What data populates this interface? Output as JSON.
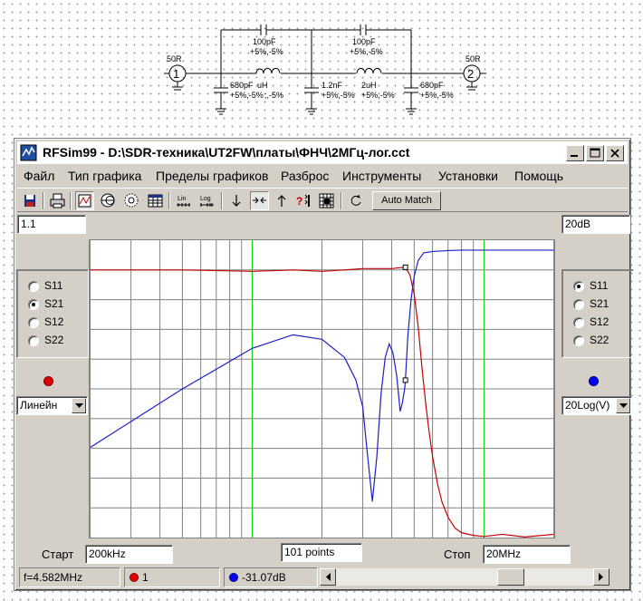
{
  "schematic": {
    "port1": {
      "name": "50R",
      "number": "1"
    },
    "port2": {
      "name": "50R",
      "number": "2"
    },
    "cap_top_1": {
      "value": "100pF",
      "tol": "+5%,-5%"
    },
    "cap_top_2": {
      "value": "100pF",
      "tol": "+5%,-5%"
    },
    "ind_1": {
      "value": "uH",
      "tol": ";,-5%"
    },
    "ind_2": {
      "value": "2uH",
      "tol": "+5%,-5%"
    },
    "cap_shunt_1": {
      "value": "680pF",
      "tol": "+5%,-5%"
    },
    "cap_shunt_2": {
      "value": "1.2nF",
      "tol": "+5%,-5%"
    },
    "cap_shunt_3": {
      "value": "680pF",
      "tol": "+5%,-5%"
    }
  },
  "window": {
    "title": "RFSim99 - D:\\SDR-техника\\UT2FW\\платы\\ФНЧ\\2МГц-лог.cct"
  },
  "menu": [
    "Файл",
    "Тип графика",
    "Пределы графиков",
    "Разброс",
    "Инструменты",
    "Установки",
    "Помощь"
  ],
  "toolbar": {
    "automatch_label": "Auto Match",
    "icons": [
      "save-icon",
      "print-icon",
      "rect-plot-icon",
      "smith-chart-icon",
      "polar-chart-icon",
      "table-icon",
      "lin-scale-icon",
      "log-scale-icon",
      "marker-down-icon",
      "marker-center-icon",
      "marker-up-icon",
      "help-context-icon",
      "grid-icon",
      "rotate-icon"
    ],
    "lin_label": "Lin",
    "log_label": "Log"
  },
  "left": {
    "scale_value": "1.1",
    "radio_options": [
      "S11",
      "S21",
      "S12",
      "S22"
    ],
    "selected": "S21",
    "indicator_color": "#dd0000",
    "scale_mode": "Линейн"
  },
  "right": {
    "scale_value": "20dB",
    "radio_options": [
      "S11",
      "S21",
      "S12",
      "S22"
    ],
    "selected": "S11",
    "indicator_color": "#0000ee",
    "scale_mode": "20Log(V)"
  },
  "bottom": {
    "start_label": "Старт",
    "start_value": "200kHz",
    "points_value": "101 points",
    "stop_label": "Стоп",
    "stop_value": "20MHz"
  },
  "status": {
    "frequency": "f=4.582MHz",
    "trace1_value": "1",
    "trace2_value": "-31.07dB"
  },
  "chart_data": {
    "type": "line",
    "x_scale": "log",
    "x_range": [
      "200kHz",
      "20MHz"
    ],
    "grid": true,
    "series": [
      {
        "color": "#c00000",
        "axis": "left",
        "x_mhz": [
          0.2,
          0.5,
          1.0,
          1.5,
          2.0,
          2.5,
          3.0,
          3.5,
          4.0,
          4.3,
          4.582,
          4.8,
          5.0,
          5.2,
          5.4,
          5.6,
          5.8,
          6.0,
          6.3,
          6.6,
          7.0,
          7.5,
          8.0,
          9.0,
          10.0,
          12.0,
          15.0,
          20.0
        ],
        "y": [
          0.99,
          0.99,
          0.985,
          0.99,
          0.985,
          0.99,
          0.995,
          0.995,
          0.995,
          0.998,
          1.0,
          0.97,
          0.9,
          0.78,
          0.63,
          0.5,
          0.39,
          0.3,
          0.2,
          0.13,
          0.075,
          0.035,
          0.018,
          0.008,
          0.004,
          0.012,
          0.002,
          0.012
        ]
      },
      {
        "color": "#1c1cc8",
        "axis": "right",
        "x_mhz": [
          0.2,
          0.5,
          1.0,
          1.5,
          2.0,
          2.5,
          2.8,
          3.0,
          3.15,
          3.3,
          3.45,
          3.6,
          3.75,
          3.9,
          4.05,
          4.2,
          4.35,
          4.45,
          4.55,
          4.582,
          4.7,
          4.85,
          5.0,
          5.2,
          5.5,
          6.0,
          7.0,
          8.0,
          10.0,
          15.0,
          20.0
        ],
        "y": [
          -46,
          -33,
          -24,
          -21,
          -22,
          -26,
          -31,
          -37,
          -48,
          -58,
          -48,
          -34,
          -26,
          -23,
          -25,
          -30,
          -38,
          -36,
          -33,
          -31.07,
          -21,
          -13,
          -8,
          -4.5,
          -2.8,
          -2.5,
          -2.3,
          -2.2,
          -2.2,
          -2.2,
          -2.2
        ]
      }
    ],
    "markers": [
      {
        "series": 0,
        "x_mhz": 4.582,
        "y": 1.0
      },
      {
        "series": 1,
        "x_mhz": 4.582,
        "y": -31.07
      }
    ]
  }
}
